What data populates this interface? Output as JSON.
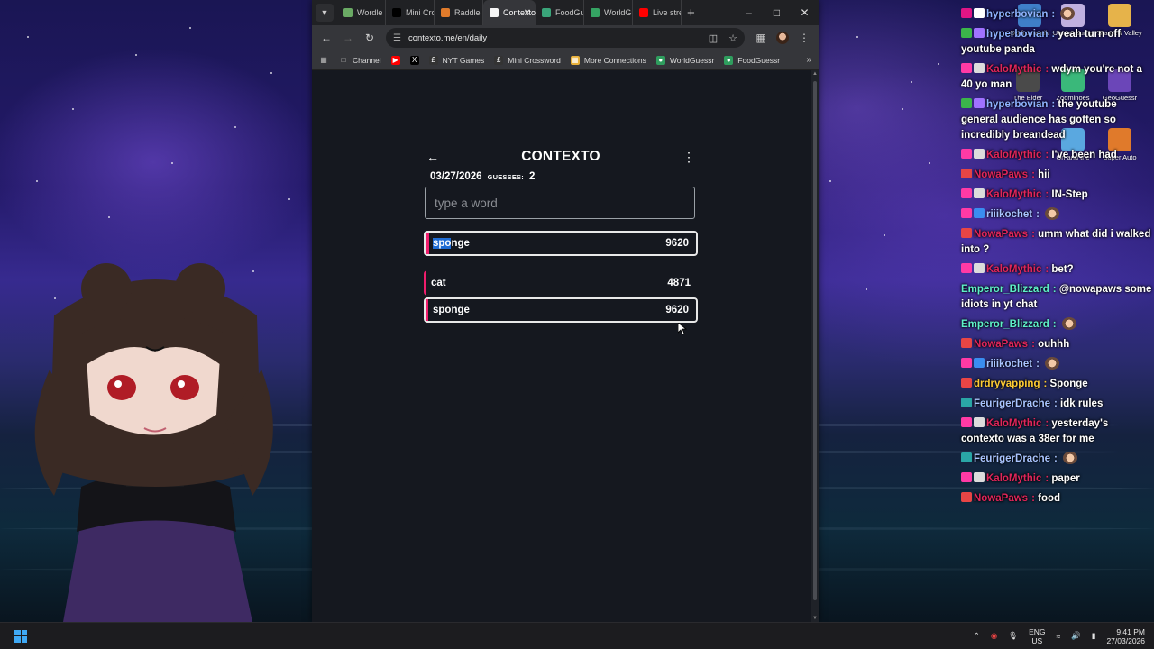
{
  "browser": {
    "tabs": [
      {
        "label": "Wordle",
        "icon": "grid-icon",
        "color": "#6aaa64"
      },
      {
        "label": "Mini Crossword",
        "icon": "nyt-icon",
        "color": "#000000"
      },
      {
        "label": "Raddle",
        "icon": "raddle-icon",
        "color": "#e07b2b"
      },
      {
        "label": "Contexto",
        "icon": "contexto-icon",
        "color": "#f5f5f5",
        "active": true
      },
      {
        "label": "FoodGuessr",
        "icon": "globe-icon",
        "color": "#3aa57a"
      },
      {
        "label": "WorldGuessr",
        "icon": "globe-icon",
        "color": "#35a363"
      },
      {
        "label": "Live stream",
        "icon": "youtube-icon",
        "color": "#ff0000"
      }
    ],
    "url": "contexto.me/en/daily",
    "bookmarks": [
      {
        "label": "Channel",
        "icon": "folder-icon"
      },
      {
        "label": "",
        "icon": "youtube-icon"
      },
      {
        "label": "",
        "icon": "x-icon"
      },
      {
        "label": "NYT Games",
        "icon": "nyt-icon"
      },
      {
        "label": "Mini Crossword",
        "icon": "nyt-icon"
      },
      {
        "label": "More Connections",
        "icon": "grid-icon"
      },
      {
        "label": "WorldGuessr",
        "icon": "globe-icon"
      },
      {
        "label": "FoodGuessr",
        "icon": "globe-icon"
      }
    ]
  },
  "game": {
    "title": "CONTEXTO",
    "date": "03/27/2026",
    "guesses_label": "GUESSES:",
    "guesses_count": "2",
    "input_placeholder": "type a word",
    "last_guess": {
      "word": "sponge",
      "rank": "9620",
      "highlight": "spo",
      "rest": "nge"
    },
    "guesses": [
      {
        "word": "cat",
        "rank": "4871"
      },
      {
        "word": "sponge",
        "rank": "9620"
      }
    ],
    "colors": {
      "bar": "#f01d6c",
      "highlight": "#1f6cd4"
    }
  },
  "desktop_icons": [
    {
      "label": "Dorfromantik",
      "color": "#3f7fc9"
    },
    {
      "label": "Umamusume",
      "color": "#c0b0e0"
    },
    {
      "label": "Stardew Valley",
      "color": "#e6b34a"
    },
    {
      "label": "The Elder",
      "color": "#4a4a4a"
    },
    {
      "label": "Zoominoes",
      "color": "#3ab87a"
    },
    {
      "label": "GeoGuessr",
      "color": "#6b46b8"
    },
    {
      "label": "Ori and the",
      "color": "#5aa8e0"
    },
    {
      "label": "Super Auto",
      "color": "#e07a2b"
    }
  ],
  "chat": [
    {
      "user": "hyperbovian",
      "color": "#8fb3ff",
      "text": "",
      "badges": [
        "#e01585",
        "#ffffff"
      ]
    },
    {
      "user": "hyperbovian",
      "color": "#8fb3ff",
      "text": "yeah turn off youtube panda",
      "badges": [
        "#3bb54a",
        "#a072ff"
      ]
    },
    {
      "user": "KaloMythic",
      "color": "#e0255a",
      "text": "wdym you're not a 40 yo man",
      "badges": [
        "#ff3aa5",
        "#dcdcdc"
      ]
    },
    {
      "user": "hyperbovian",
      "color": "#8fb3ff",
      "text": "the youtube general audience has gotten so incredibly breandead",
      "badges": [
        "#3bb54a",
        "#a072ff"
      ]
    },
    {
      "user": "KaloMythic",
      "color": "#e0255a",
      "text": "I've been had",
      "badges": [
        "#ff3aa5",
        "#dcdcdc"
      ]
    },
    {
      "user": "NowaPaws",
      "color": "#e0255a",
      "text": "hii",
      "badges": [
        "#e84545"
      ]
    },
    {
      "user": "KaloMythic",
      "color": "#e0255a",
      "text": "IN-Step",
      "badges": [
        "#ff3aa5",
        "#dcdcdc"
      ]
    },
    {
      "user": "riiikochet",
      "color": "#a9c4ff",
      "text": "",
      "badges": [
        "#ff3aa5",
        "#3a8df0"
      ]
    },
    {
      "user": "NowaPaws",
      "color": "#e0255a",
      "text": "umm what did i walked into ?",
      "badges": [
        "#e84545"
      ]
    },
    {
      "user": "KaloMythic",
      "color": "#e0255a",
      "text": "bet?",
      "badges": [
        "#ff3aa5",
        "#dcdcdc"
      ]
    },
    {
      "user": "Emperor_Blizzard",
      "color": "#5ef0c8",
      "text": "@nowapaws some idiots in yt chat",
      "badges": []
    },
    {
      "user": "Emperor_Blizzard",
      "color": "#5ef0c8",
      "text": "",
      "badges": []
    },
    {
      "user": "NowaPaws",
      "color": "#e0255a",
      "text": "ouhhh",
      "badges": [
        "#e84545"
      ]
    },
    {
      "user": "riiikochet",
      "color": "#a9c4ff",
      "text": "",
      "badges": [
        "#ff3aa5",
        "#3a8df0"
      ]
    },
    {
      "user": "drdryyapping",
      "color": "#ffcc33",
      "text": "Sponge",
      "badges": [
        "#e84545"
      ]
    },
    {
      "user": "FeurigerDrache",
      "color": "#a9c4ff",
      "text": "idk rules",
      "badges": [
        "#2aa6a6"
      ]
    },
    {
      "user": "KaloMythic",
      "color": "#e0255a",
      "text": "yesterday's contexto was a 38er for me",
      "badges": [
        "#ff3aa5",
        "#dcdcdc"
      ]
    },
    {
      "user": "FeurigerDrache",
      "color": "#a9c4ff",
      "text": "",
      "badges": [
        "#2aa6a6"
      ]
    },
    {
      "user": "KaloMythic",
      "color": "#e0255a",
      "text": "paper",
      "badges": [
        "#ff3aa5",
        "#dcdcdc"
      ]
    },
    {
      "user": "NowaPaws",
      "color": "#e0255a",
      "text": "food",
      "badges": [
        "#e84545"
      ]
    }
  ],
  "taskbar": {
    "lang_top": "ENG",
    "lang_bottom": "US",
    "time": "9:41 PM",
    "date": "27/03/2026"
  }
}
